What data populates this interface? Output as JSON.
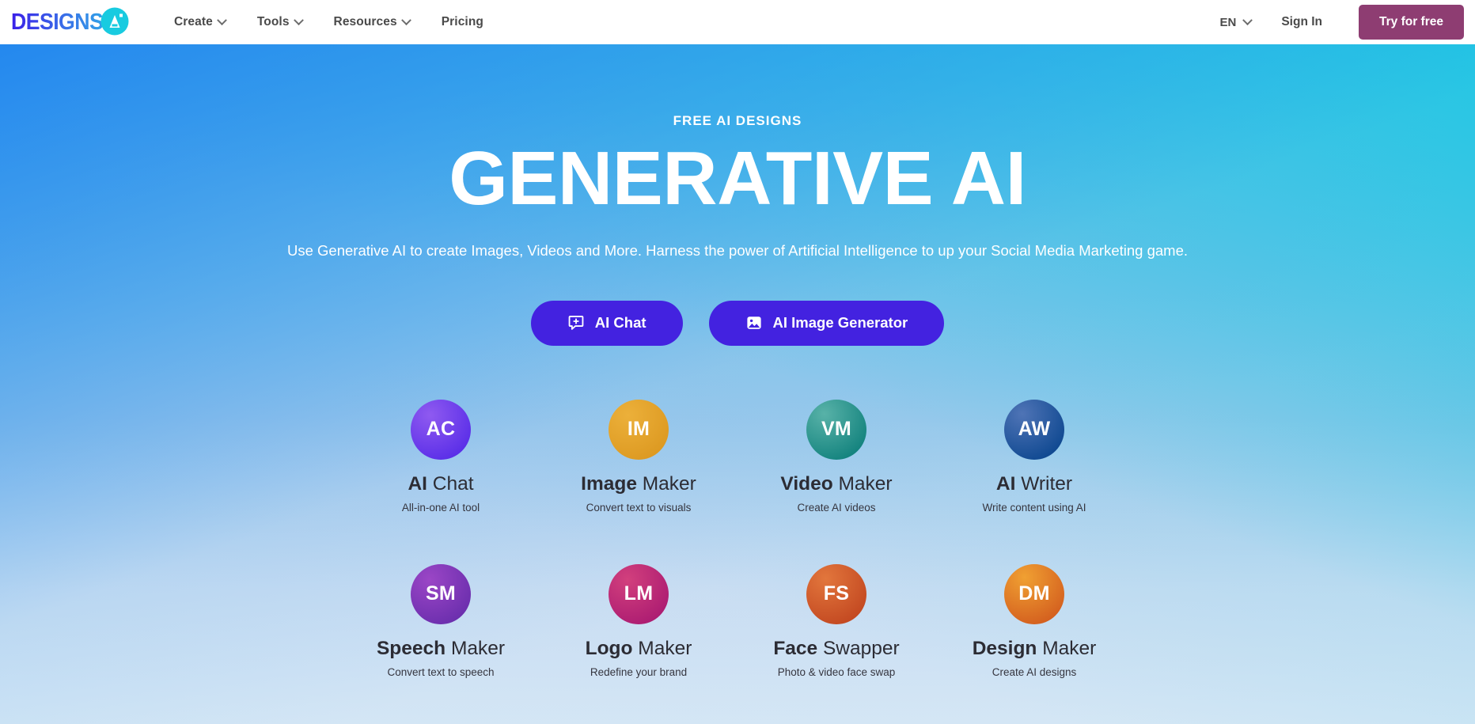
{
  "header": {
    "logo": {
      "text": "DESIGNS.",
      "badge": "AI",
      "name": "designs-ai-logo"
    },
    "nav": [
      {
        "label": "Create",
        "has_caret": true
      },
      {
        "label": "Tools",
        "has_caret": true
      },
      {
        "label": "Resources",
        "has_caret": true
      },
      {
        "label": "Pricing",
        "has_caret": false
      }
    ],
    "language": {
      "label": "EN",
      "has_caret": true
    },
    "sign_in": "Sign In",
    "try_free": "Try for free"
  },
  "hero": {
    "eyebrow": "FREE AI DESIGNS",
    "title": "GENERATIVE AI",
    "subtitle": "Use Generative AI to create Images, Videos and More. Harness the power of Artificial Intelligence to up your Social Media Marketing game.",
    "cta": [
      {
        "label": "AI Chat",
        "icon": "chat-plus-icon",
        "color": "#4322e0"
      },
      {
        "label": "AI Image Generator",
        "icon": "image-icon",
        "color": "#4322e0"
      }
    ]
  },
  "tools": [
    {
      "initials": "AC",
      "title_bold": "AI",
      "title_light": "Chat",
      "desc": "All-in-one AI tool",
      "color_from": "#8f5af0",
      "color_to": "#5b2fe8",
      "slug": "ai-chat"
    },
    {
      "initials": "IM",
      "title_bold": "Image",
      "title_light": "Maker",
      "desc": "Convert text to visuals",
      "color_from": "#ecb03a",
      "color_to": "#dd9a22",
      "slug": "image-maker"
    },
    {
      "initials": "VM",
      "title_bold": "Video",
      "title_light": "Maker",
      "desc": "Create AI videos",
      "color_from": "#58b2a8",
      "color_to": "#15847f",
      "slug": "video-maker"
    },
    {
      "initials": "AW",
      "title_bold": "AI",
      "title_light": "Writer",
      "desc": "Write content using AI",
      "color_from": "#4f74b6",
      "color_to": "#114a92",
      "slug": "ai-writer"
    },
    {
      "initials": "SM",
      "title_bold": "Speech",
      "title_light": "Maker",
      "desc": "Convert text to speech",
      "color_from": "#9b46c6",
      "color_to": "#6c2fae",
      "slug": "speech-maker"
    },
    {
      "initials": "LM",
      "title_bold": "Logo",
      "title_light": "Maker",
      "desc": "Redefine your brand",
      "color_from": "#d2407d",
      "color_to": "#ad1d72",
      "slug": "logo-maker"
    },
    {
      "initials": "FS",
      "title_bold": "Face",
      "title_light": "Swapper",
      "desc": "Photo & video face swap",
      "color_from": "#e2763c",
      "color_to": "#c44a22",
      "slug": "face-swapper"
    },
    {
      "initials": "DM",
      "title_bold": "Design",
      "title_light": "Maker",
      "desc": "Create AI designs",
      "color_from": "#f0a032",
      "color_to": "#d4601f",
      "slug": "design-maker"
    }
  ],
  "theme": {
    "accent_purple": "#4322e0",
    "brand_magenta": "#8e3d72",
    "bg_blue": "#2488ee",
    "bg_cyan": "#11c9e0",
    "bg_light": "#cde2f4"
  }
}
